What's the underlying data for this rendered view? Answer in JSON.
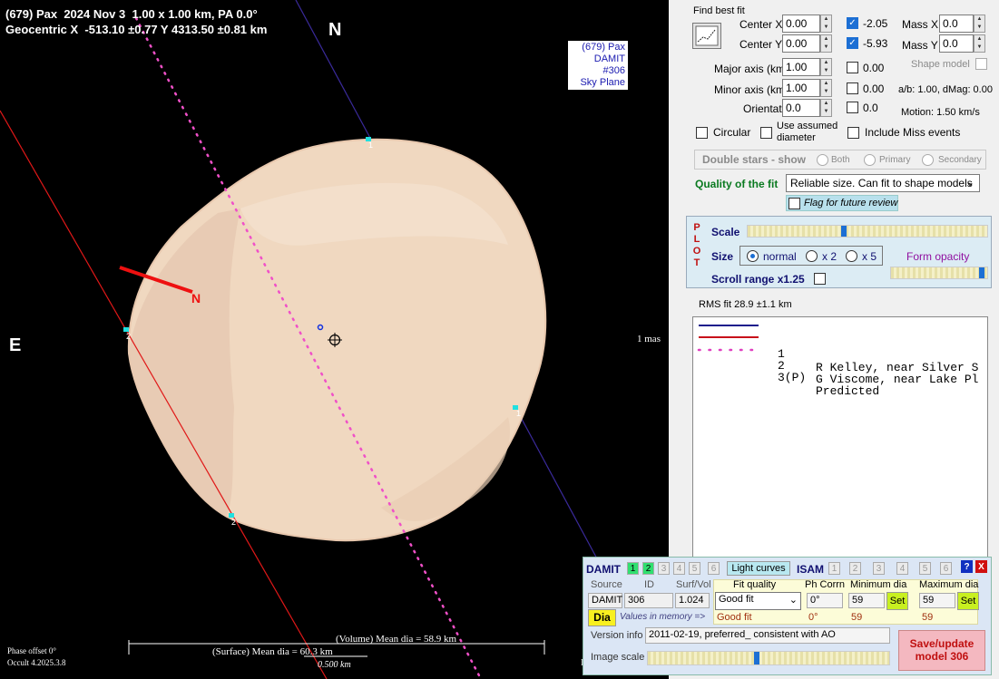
{
  "plot": {
    "header_line1": "(679) Pax  2024 Nov 3  1.00 x 1.00 km, PA 0.0°",
    "header_line2": "Geocentric X  -513.10 ±0.77 Y 4313.50 ±0.81 km",
    "north_label": "N",
    "east_label": "E",
    "badge_line1": "(679) Pax",
    "badge_line2": "DAMIT #306",
    "badge_line3": "Sky Plane",
    "scale_mas": "1 mas",
    "chord1_a": "1",
    "chord1_b": "1",
    "chord2_a": "2",
    "chord2_b": "2",
    "pole_label": "N",
    "volume_dia": "(Volume) Mean dia = 58.9 km",
    "surface_dia": "(Surface) Mean dia = 60.3 km",
    "scale_km": "0.500 km",
    "phase_offset": "Phase offset 0°",
    "version": "Occult 4.2025.3.8",
    "edge_char": "I"
  },
  "fit": {
    "find_best_fit": "Find best fit",
    "center_x_label": "Center X",
    "center_x": "0.00",
    "center_x_result": "-2.05",
    "center_y_label": "Center Y",
    "center_y": "0.00",
    "center_y_result": "-5.93",
    "mass_x_label": "Mass X",
    "mass_x": "0.0",
    "mass_y_label": "Mass Y",
    "mass_y": "0.0",
    "major_label": "Major axis (km)",
    "major": "1.00",
    "major_result": "0.00",
    "minor_label": "Minor axis (km)",
    "minor": "1.00",
    "minor_result": "0.00",
    "orientation_label": "Orientation",
    "orientation": "0.0",
    "orientation_result": "0.0",
    "shape_model": "Shape model",
    "ab_dmag": "a/b: 1.00, dMag: 0.00",
    "motion": "Motion: 1.50 km/s",
    "circular": "Circular",
    "use_assumed_1": "Use assumed",
    "use_assumed_2": "diameter",
    "include_miss": "Include Miss events",
    "double_stars": "Double stars - show",
    "both": "Both",
    "primary": "Primary",
    "secondary": "Secondary",
    "quality_label": "Quality of the fit",
    "quality_value": "Reliable size. Can fit to shape models",
    "flag_review": "Flag for future review"
  },
  "plotpanel": {
    "plot_vertical": "P L O T",
    "scale": "Scale",
    "size": "Size",
    "normal": "normal",
    "x2": "x 2",
    "x5": "x 5",
    "form_opacity": "Form opacity",
    "scroll_range": "Scroll range x1.25",
    "scale_value": 0.4,
    "opacity_value": 0.97
  },
  "rms": "RMS fit 28.9 ±1.1 km",
  "legend": [
    {
      "num": "1",
      "text": "R Kelley, near Silver S",
      "color": "#1a1a8c",
      "style": "solid"
    },
    {
      "num": "2",
      "text": "G Viscome, near Lake Pl",
      "color": "#c8101a",
      "style": "solid"
    },
    {
      "num": "3(P)",
      "text": "Predicted",
      "color": "#e040c0",
      "style": "dotted"
    }
  ],
  "damit": {
    "title": "DAMIT",
    "tabs": [
      "1",
      "2",
      "3",
      "4",
      "5",
      "6"
    ],
    "light_curves": "Light curves",
    "isam": "ISAM",
    "isam_tabs": [
      "1",
      "2",
      "3",
      "4",
      "5",
      "6"
    ],
    "help": "?",
    "close": "X",
    "source_label": "Source",
    "id_label": "ID",
    "surfvol_label": "Surf/Vol",
    "fitq_label": "Fit quality",
    "phcorr_label": "Ph Corrn",
    "mindia_label": "Minimum dia",
    "maxdia_label": "Maximum dia",
    "source": "DAMIT",
    "id": "306",
    "surfvol": "1.024",
    "fit_quality": "Good fit",
    "ph_corr": "0°",
    "min_dia": "59",
    "max_dia": "59",
    "set": "Set",
    "dia_btn": "Dia",
    "memory_label": "Values in memory =>",
    "mem_fit": "Good fit",
    "mem_ph": "0°",
    "mem_min": "59",
    "mem_max": "59",
    "version_label": "Version info",
    "version_value": "2011-02-19, preferred_ consistent with AO",
    "image_scale": "Image scale",
    "save_line1": "Save/update",
    "save_line2": "model 306",
    "image_scale_value": 0.45
  }
}
